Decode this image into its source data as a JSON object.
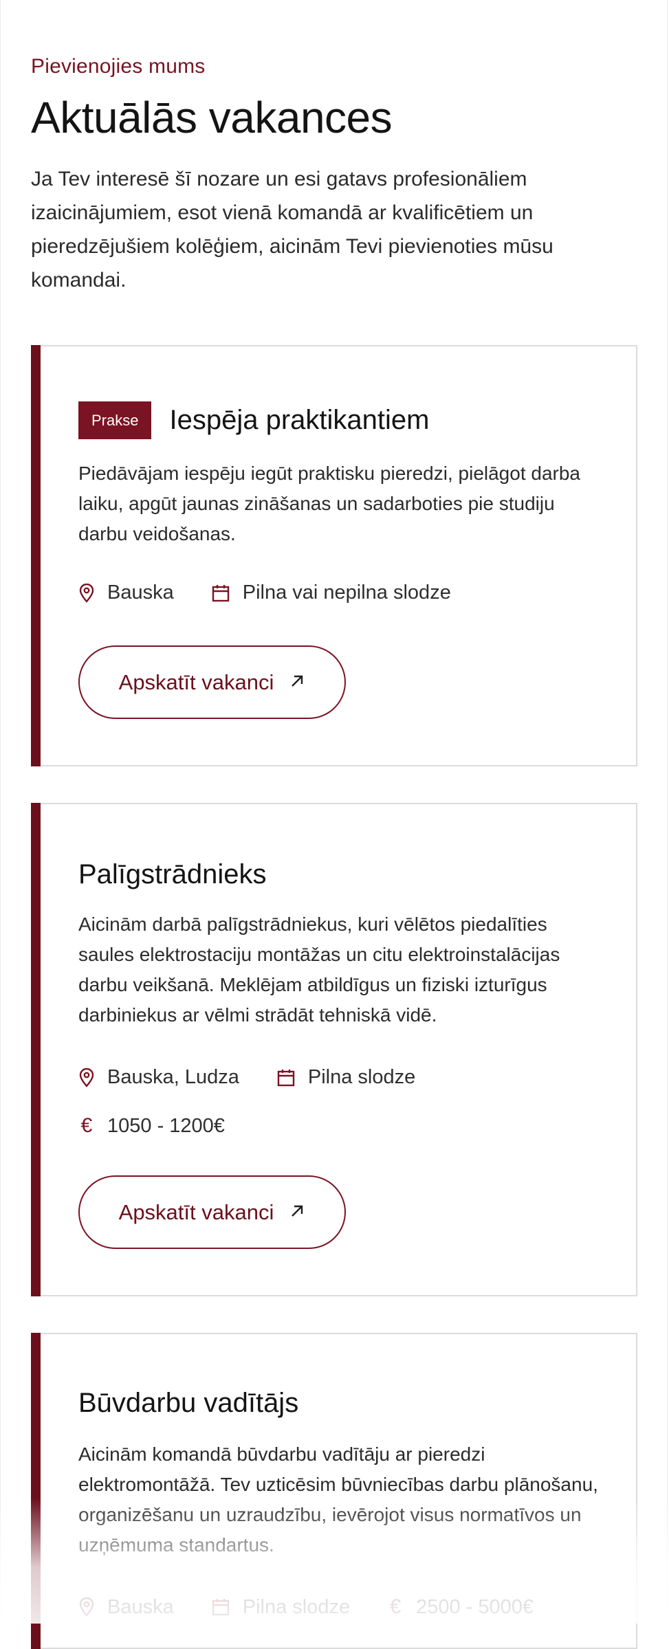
{
  "header": {
    "eyebrow": "Pievienojies mums",
    "title": "Aktuālās vakances",
    "intro": "Ja Tev interesē šī nozare un esi gatavs profesionāliem izaicinājumiem, esot vienā komandā ar kvalificētiem un pieredzējušiem kolēģiem, aicinām Tevi pievienoties mūsu komandai."
  },
  "colors": {
    "accent": "#7a1323",
    "accent_dark": "#6c0f1d",
    "border": "#dcdcdc"
  },
  "icons": {
    "location": "map-pin-icon",
    "schedule": "calendar-icon",
    "salary": "euro-icon",
    "button": "arrow-up-right-icon"
  },
  "vacancies": [
    {
      "badge": "Prakse",
      "title": "Iespēja praktikantiem",
      "description": "Piedāvājam iespēju iegūt praktisku pieredzi, pielāgot darba laiku, apgūt jaunas zināšanas un sadarboties pie studiju darbu veidošanas.",
      "location": "Bauska",
      "schedule": "Pilna vai nepilna slodze",
      "button": "Apskatīt vakanci"
    },
    {
      "title": "Palīgstrādnieks",
      "description": "Aicinām darbā palīgstrādniekus, kuri vēlētos piedalīties saules elektrostaciju montāžas un citu elektroinstalācijas darbu veikšanā. Meklējam atbildīgus un fiziski izturīgus darbiniekus ar vēlmi strādāt tehniskā vidē.",
      "location": "Bauska, Ludza",
      "schedule": "Pilna slodze",
      "salary": "1050 - 1200€",
      "button": "Apskatīt vakanci"
    },
    {
      "title": "Būvdarbu vadītājs",
      "description": "Aicinām komandā būvdarbu vadītāju ar pieredzi elektromontāžā. Tev uzticēsim būvniecības darbu plānošanu, organizēšanu un uzraudzību, ievērojot visus normatīvos un uzņēmuma standartus.",
      "location": "Bauska",
      "schedule": "Pilna slodze",
      "salary": "2500 - 5000€"
    }
  ]
}
